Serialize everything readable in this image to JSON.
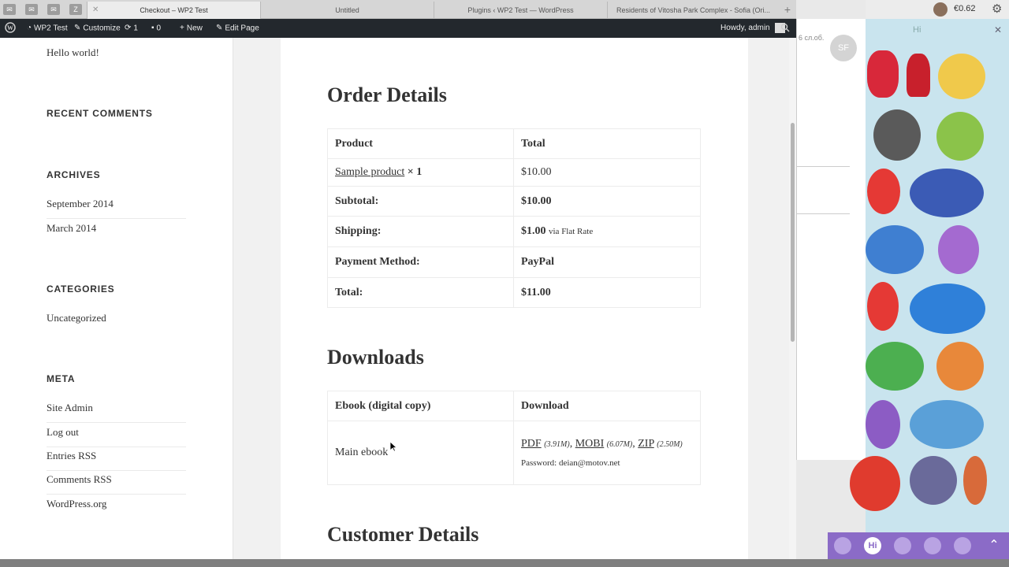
{
  "browser": {
    "tabs": [
      {
        "title": "Checkout – WP2 Test",
        "active": true
      },
      {
        "title": "Untitled",
        "active": false
      },
      {
        "title": "Plugins ‹ WP2 Test — WordPress",
        "active": false
      },
      {
        "title": "Residents of Vitosha Park Complex - Sofia (Ori...",
        "active": false
      }
    ],
    "new_tab": "+"
  },
  "admin_bar": {
    "site": "WP2 Test",
    "customize": "Customize",
    "updates": "1",
    "comments": "0",
    "new": "New",
    "edit_page": "Edit Page",
    "greeting": "Howdy, admin"
  },
  "sidebar": {
    "hello": "Hello world!",
    "recent_comments_title": "RECENT COMMENTS",
    "archives_title": "ARCHIVES",
    "archives": [
      "September 2014",
      "March 2014"
    ],
    "categories_title": "CATEGORIES",
    "categories": [
      "Uncategorized"
    ],
    "meta_title": "META",
    "meta": [
      "Site Admin",
      "Log out",
      "Entries RSS",
      "Comments RSS",
      "WordPress.org"
    ]
  },
  "order": {
    "title": "Order Details",
    "header_product": "Product",
    "header_total": "Total",
    "product_name": "Sample product",
    "product_qty": "× 1",
    "product_total": "$10.00",
    "subtotal_label": "Subtotal:",
    "subtotal_value": "$10.00",
    "shipping_label": "Shipping:",
    "shipping_value": "$1.00",
    "shipping_via": "via Flat Rate",
    "payment_label": "Payment Method:",
    "payment_value": "PayPal",
    "total_label": "Total:",
    "total_value": "$11.00"
  },
  "downloads": {
    "title": "Downloads",
    "header_item": "Ebook (digital copy)",
    "header_download": "Download",
    "item_name": "Main ebook",
    "pdf": "PDF",
    "pdf_size": "(3.91M)",
    "mobi": "MOBI",
    "mobi_size": "(6.07M)",
    "zip": "ZIP",
    "zip_size": "(2.50M)",
    "password": "Password: deian@motov.net"
  },
  "customer": {
    "title": "Customer Details"
  },
  "overlay": {
    "balance": "€0.62",
    "chat_timestamp": "6 сл.об.",
    "chat_avatar": "SF",
    "sticker_header": "Hi",
    "sticker_tab_hi": "Hi"
  },
  "colors": {
    "admin_bar": "#23282d",
    "sticker_bar": "#8b6bc7",
    "sticker_bg": "#c9e4ee"
  }
}
